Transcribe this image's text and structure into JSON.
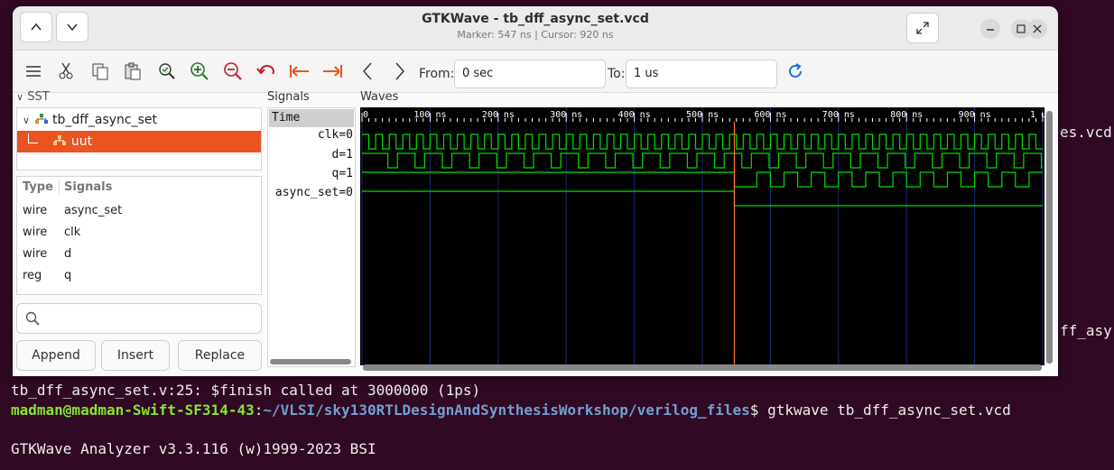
{
  "terminal": {
    "finish_line": "tb_dff_async_set.v:25: $finish called at 3000000 (1ps)",
    "prompt_user": "madman@madman-Swift-SF314-43",
    "prompt_sep": ":",
    "prompt_path": "~/VLSI/sky130RTLDesignAndSynthesisWorkshop/verilog_files",
    "prompt_cmd": "$ gtkwave tb_dff_async_set.vcd",
    "analyzer_line": "GTKWave Analyzer v3.3.116 (w)1999-2023 BSI",
    "right_frag_1": "es.vcd",
    "right_frag_2": "ff_asy"
  },
  "window": {
    "title": "GTKWave - tb_dff_async_set.vcd",
    "subtitle": "Marker: 547 ns  |  Cursor: 920 ns"
  },
  "toolbar": {
    "from_label": "From:",
    "from_value": "0 sec",
    "to_label": "To:",
    "to_value": "1 us"
  },
  "sst": {
    "header": "SST",
    "tree": [
      {
        "label": "tb_dff_async_set"
      },
      {
        "label": "uut"
      }
    ],
    "columns": [
      "Type",
      "Signals"
    ],
    "rows": [
      {
        "type": "wire",
        "name": "async_set"
      },
      {
        "type": "wire",
        "name": "clk"
      },
      {
        "type": "wire",
        "name": "d"
      },
      {
        "type": "reg",
        "name": "q"
      }
    ],
    "buttons": {
      "append": "Append",
      "insert": "Insert",
      "replace": "Replace"
    }
  },
  "signals": {
    "header": "Signals",
    "time_label": "Time",
    "list": [
      {
        "name": "clk",
        "value": "0"
      },
      {
        "name": "d",
        "value": "1"
      },
      {
        "name": "q",
        "value": "1"
      },
      {
        "name": "async_set",
        "value": "0"
      }
    ]
  },
  "waves": {
    "header": "Waves",
    "ruler": [
      "0",
      "100 ns",
      "200 ns",
      "300 ns",
      "400 ns",
      "500 ns",
      "600 ns",
      "700 ns",
      "800 ns",
      "900 ns",
      "1 u"
    ],
    "marker_ns": 547,
    "window_ns": 1000,
    "clk_period_ns": 20,
    "d_toggles_ns": [
      0,
      38,
      52,
      78,
      92,
      118,
      132,
      158,
      172,
      198,
      212,
      238,
      252,
      278,
      292,
      318,
      332,
      358,
      372,
      398,
      412,
      438,
      452,
      478,
      492,
      518,
      532,
      558,
      572,
      598,
      612,
      638,
      652,
      678,
      692,
      718,
      732,
      758,
      772,
      798,
      812,
      838,
      852,
      878,
      892,
      918,
      932,
      958,
      972,
      998
    ],
    "q_toggles_ns": [
      547,
      580,
      600,
      620,
      640,
      660,
      680,
      700,
      720,
      740,
      760,
      780,
      800,
      820,
      840,
      860,
      880,
      900,
      920,
      940,
      960,
      980
    ],
    "colors": {
      "wave": "#00e000",
      "grid": "#1a2a7a",
      "marker": "#ff7733",
      "bg": "#000000"
    }
  }
}
